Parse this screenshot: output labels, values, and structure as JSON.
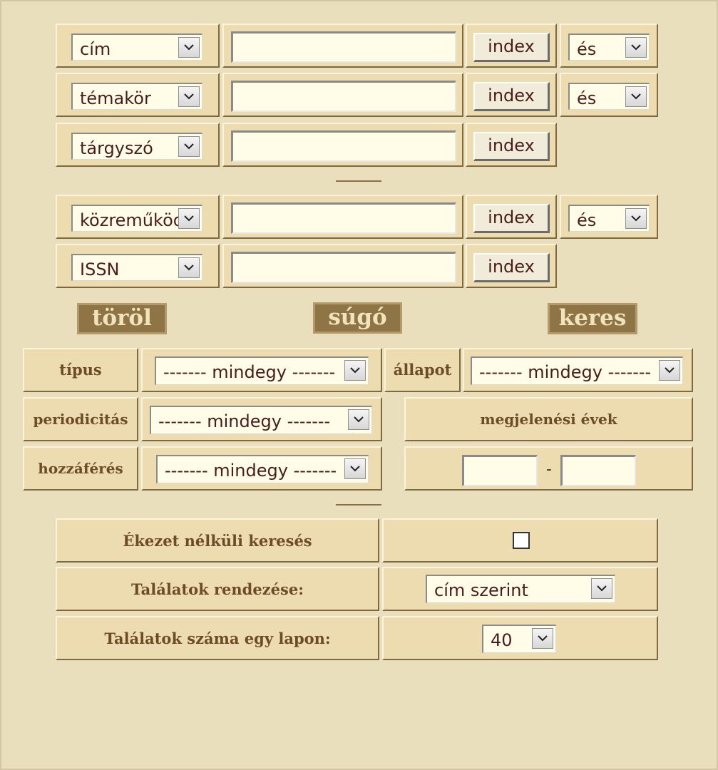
{
  "search_rows": [
    {
      "field": "cím",
      "index_label": "index",
      "operator": "és"
    },
    {
      "field": "témakör",
      "index_label": "index",
      "operator": "és"
    },
    {
      "field": "tárgyszó",
      "index_label": "index"
    },
    {
      "field": "közreműköd",
      "index_label": "index",
      "operator": "és"
    },
    {
      "field": "ISSN",
      "index_label": "index"
    }
  ],
  "actions": {
    "clear": "töröl",
    "help": "súgó",
    "search": "keres"
  },
  "filters": {
    "type_label": "típus",
    "type_value": "------- mindegy -------",
    "status_label": "állapot",
    "status_value": "------- mindegy -------",
    "periodicity_label": "periodicitás",
    "periodicity_value": "------- mindegy -------",
    "access_label": "hozzáférés",
    "access_value": "------- mindegy -------",
    "years_label": "megjelenési évek",
    "years_from": "",
    "years_to": "",
    "years_dash": "-"
  },
  "options": {
    "accentless_label": "Ékezet nélküli keresés",
    "accentless_checked": false,
    "sort_label": "Találatok rendezése:",
    "sort_value": "cím szerint",
    "per_page_label": "Találatok száma egy lapon:",
    "per_page_value": "40"
  }
}
